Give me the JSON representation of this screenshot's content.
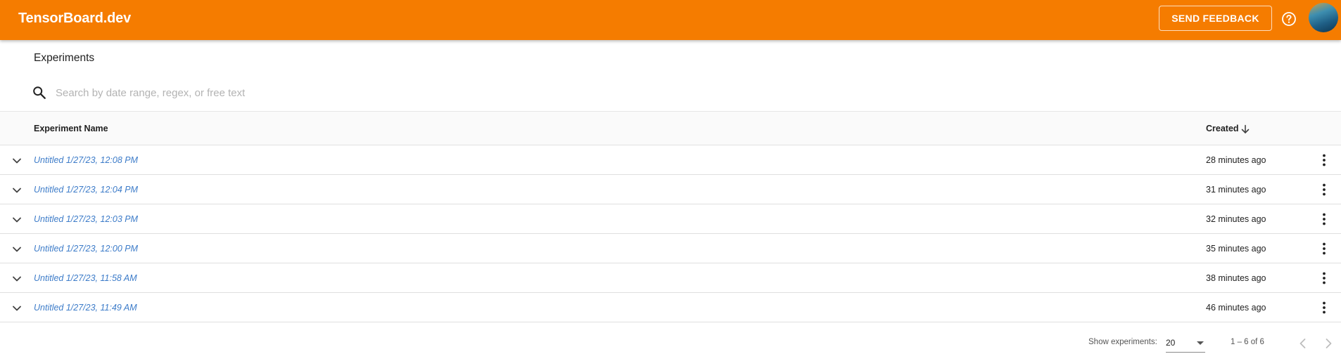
{
  "header": {
    "brand": "TensorBoard.dev",
    "send_feedback_label": "SEND FEEDBACK",
    "help_icon": "help-circle-icon",
    "avatar": "user-avatar",
    "accent_color": "#f57c00"
  },
  "page": {
    "title": "Experiments"
  },
  "search": {
    "placeholder": "Search by date range, regex, or free text",
    "value": "",
    "icon": "search-icon"
  },
  "table": {
    "columns": {
      "name": "Experiment Name",
      "created": "Created",
      "sort_icon": "arrow-down-icon"
    },
    "rows": [
      {
        "name": "Untitled 1/27/23, 12:08 PM",
        "created": "28 minutes ago"
      },
      {
        "name": "Untitled 1/27/23, 12:04 PM",
        "created": "31 minutes ago"
      },
      {
        "name": "Untitled 1/27/23, 12:03 PM",
        "created": "32 minutes ago"
      },
      {
        "name": "Untitled 1/27/23, 12:00 PM",
        "created": "35 minutes ago"
      },
      {
        "name": "Untitled 1/27/23, 11:58 AM",
        "created": "38 minutes ago"
      },
      {
        "name": "Untitled 1/27/23, 11:49 AM",
        "created": "46 minutes ago"
      }
    ],
    "link_color": "#3d7cc9"
  },
  "paginator": {
    "show_label": "Show experiments:",
    "page_size": "20",
    "range_label": "1 – 6 of 6"
  }
}
